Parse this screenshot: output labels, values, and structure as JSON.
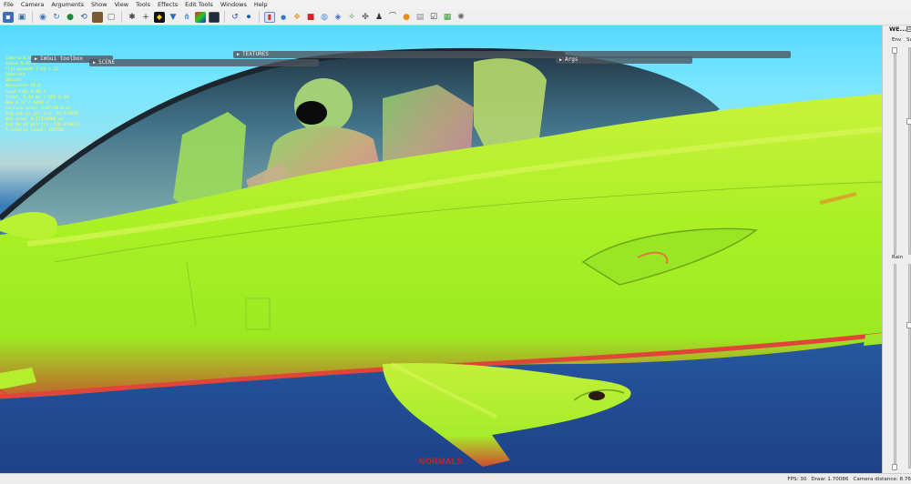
{
  "menu": [
    "File",
    "Camera",
    "Arguments",
    "Show",
    "View",
    "Tools",
    "Effects",
    "Edit Tools",
    "Windows",
    "Help"
  ],
  "toolbar_icons": [
    "save-icon",
    "screenshot-icon",
    "sep",
    "globe-icon",
    "refresh-icon",
    "green-sphere-icon",
    "reset-camera-icon",
    "cube-icon",
    "cube-outline-icon",
    "sep",
    "bug-icon",
    "crosshair-icon",
    "lighting-icon",
    "cone-icon",
    "network-icon",
    "palette-icon",
    "monitor-icon",
    "sep",
    "undo-icon",
    "record-icon",
    "sep",
    "chart-icon",
    "dot-icon",
    "cubes-icon",
    "red-box-icon",
    "sphere-icon",
    "blue-orb-icon",
    "compass-icon",
    "fan-icon",
    "person-icon",
    "arch-icon",
    "orange-ball-icon",
    "transparent-box-icon",
    "checkbox-icon",
    "grid-icon",
    "sun-icon"
  ],
  "stats": [
    "Camera:0.09 s",
    "Scene 0.05 s",
    "Flying/path  7.63 s 22",
    "Generate",
    "Upload",
    "Resources 68.6",
    "Load time 0.00 s",
    "Total: 0.44 ms / GPU 0.30",
    "Mem 4.17 / 6090 s",
    "Surface area: 1.07/80.0 m2",
    "Avg sub px per tri: 24.754659",
    "Bvh area: 0.177/0060 px",
    "Avg bb px per tri: 118.319823",
    "Triangles count: 445758"
  ],
  "imgui": {
    "toolbox": "ImGui toolbox",
    "scene": "SCENE",
    "textures": "TEXTURES",
    "args": "Args"
  },
  "render_mode": "NORMALS",
  "side_panel": {
    "title": "WE...",
    "toggle": "☑",
    "col1": "Env",
    "col2": "Su",
    "rain": "Rain"
  },
  "status": {
    "fps": "FPS: 30",
    "draw": "Draw: 1.70086",
    "camera_distance": "Camera distance: 8.76"
  },
  "colors": {
    "fuselage": "#b6f12a",
    "edge_red": "#e0453a",
    "sky_top": "#57d8ff",
    "ground": "#234f96",
    "stat_text": "#ffff36",
    "render_mode_text": "#d41f1f"
  }
}
